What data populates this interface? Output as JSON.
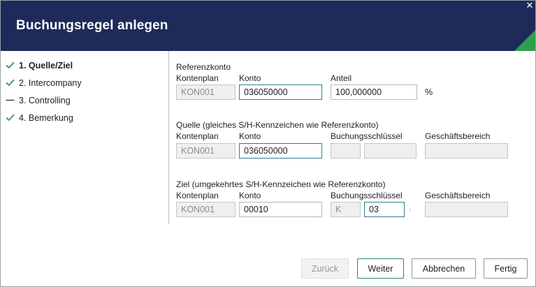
{
  "dialog": {
    "title": "Buchungsregel anlegen",
    "close_glyph": "✕",
    "accent_color": "#2e9e4f",
    "header_color": "#1e2a5a"
  },
  "steps": [
    {
      "label": "1. Quelle/Ziel",
      "status": "check-icon",
      "active": true
    },
    {
      "label": "2. Intercompany",
      "status": "check-icon",
      "active": false
    },
    {
      "label": "3. Controlling",
      "status": "dash-icon",
      "active": false
    },
    {
      "label": "4. Bemerkung",
      "status": "check-icon",
      "active": false
    }
  ],
  "referenz": {
    "title": "Referenzkonto",
    "kontenplan_label": "Kontenplan",
    "konto_label": "Konto",
    "anteil_label": "Anteil",
    "kontenplan_value": "KON001",
    "konto_value": "036050000",
    "anteil_value": "100,000000",
    "percent": "%"
  },
  "quelle": {
    "title": "Quelle (gleiches S/H-Kennzeichen wie Referenzkonto)",
    "kontenplan_label": "Kontenplan",
    "konto_label": "Konto",
    "buchungsschluessel_label": "Buchungsschlüssel",
    "geschaeftsbereich_label": "Geschäftsbereich",
    "kontenplan_value": "KON001",
    "konto_value": "036050000",
    "bs1_value": "",
    "bs2_value": "",
    "gb_value": ""
  },
  "ziel": {
    "title": "Ziel (umgekehrtes S/H-Kennzeichen wie Referenzkonto)",
    "kontenplan_label": "Kontenplan",
    "konto_label": "Konto",
    "buchungsschluessel_label": "Buchungsschlüssel",
    "geschaeftsbereich_label": "Geschäftsbereich",
    "kontenplan_value": "KON001",
    "konto_value": "00010",
    "bs1_value": "K",
    "bs2_value": "03",
    "gb_value": ""
  },
  "buttons": {
    "back": "Zurück",
    "next": "Weiter",
    "cancel": "Abbrechen",
    "finish": "Fertig"
  }
}
